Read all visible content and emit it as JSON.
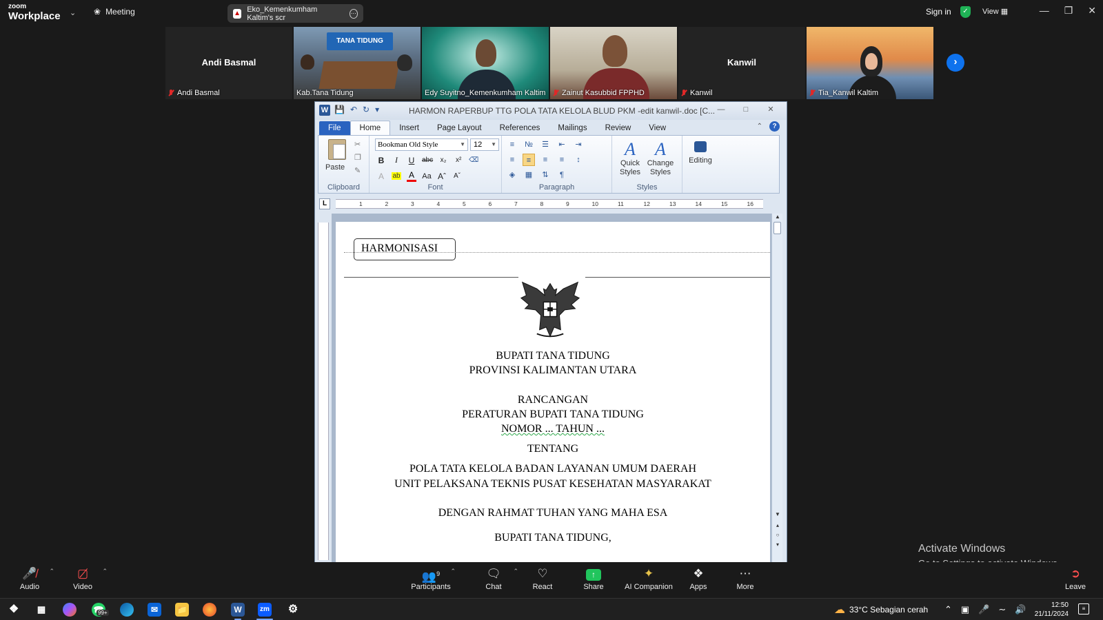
{
  "topbar": {
    "logo_top": "zoom",
    "logo_bottom": "Workplace",
    "meeting_label": "Meeting",
    "share_tab_label": "Eko_Kemenkumham Kaltim's scr",
    "sign_in": "Sign in",
    "view_label": "View"
  },
  "gallery": {
    "tiles": [
      {
        "display_name": "Andi Basmal",
        "label": "Andi Basmal",
        "video": false,
        "muted": true
      },
      {
        "display_name": "",
        "label": "Kab.Tana Tidung",
        "video": true,
        "muted": false,
        "banner": "TANA TIDUNG"
      },
      {
        "display_name": "",
        "label": "Edy Suyitno_Kemenkumham Kaltim",
        "video": true,
        "muted": false,
        "active": true
      },
      {
        "display_name": "",
        "label": "Zainut Kasubbid FPPHD",
        "video": true,
        "muted": true
      },
      {
        "display_name": "Kanwil",
        "label": "Kanwil",
        "video": false,
        "muted": true
      },
      {
        "display_name": "",
        "label": "Tia_Kanwil Kaltim",
        "video": true,
        "muted": true
      }
    ]
  },
  "word": {
    "title": "HARMON RAPERBUP TTG POLA TATA KELOLA BLUD PKM -edit kanwil-.doc [C...",
    "tabs": [
      "File",
      "Home",
      "Insert",
      "Page Layout",
      "References",
      "Mailings",
      "Review",
      "View"
    ],
    "font_name": "Bookman Old Style",
    "font_size": "12",
    "paste_label": "Paste",
    "groups": {
      "clipboard": "Clipboard",
      "font": "Font",
      "paragraph": "Paragraph",
      "styles": "Styles"
    },
    "quick_styles": [
      "Quick",
      "Styles"
    ],
    "change_styles": [
      "Change",
      "Styles"
    ],
    "editing": "Editing",
    "ruler_numbers": [
      "1",
      "2",
      "3",
      "4",
      "5",
      "6",
      "7",
      "8",
      "9",
      "10",
      "11",
      "12",
      "13",
      "14",
      "15",
      "16"
    ],
    "document": {
      "header_box": "HARMONISASI",
      "lines": [
        "BUPATI TANA TIDUNG",
        "PROVINSI KALIMANTAN UTARA",
        "RANCANGAN",
        "PERATURAN BUPATI TANA TIDUNG",
        "NOMOR ... TAHUN ...",
        "TENTANG",
        "POLA TATA KELOLA BADAN LAYANAN UMUM DAERAH",
        "UNIT PELAKSANA TEKNIS PUSAT KESEHATAN MASYARAKAT",
        "DENGAN RAHMAT TUHAN YANG MAHA ESA",
        "BUPATI TANA TIDUNG,"
      ]
    }
  },
  "watermark": {
    "line1": "Activate Windows",
    "line2": "Go to Settings to activate Windows."
  },
  "controls": {
    "audio": "Audio",
    "video": "Video",
    "participants": "Participants",
    "participants_count": "9",
    "chat": "Chat",
    "react": "React",
    "share": "Share",
    "ai_companion": "AI Companion",
    "apps": "Apps",
    "more": "More",
    "leave": "Leave"
  },
  "taskbar": {
    "whatsapp_badge": "99+",
    "weather": "33°C  Sebagian cerah",
    "time": "12:50",
    "date": "21/11/2024",
    "zoom_label": "zm",
    "word_label": "W"
  },
  "colors": {
    "zoom_bg": "#1a1a1a",
    "active_speaker": "#21c55d",
    "zoom_blue": "#0e72ed",
    "word_file_tab": "#2a63c0"
  }
}
